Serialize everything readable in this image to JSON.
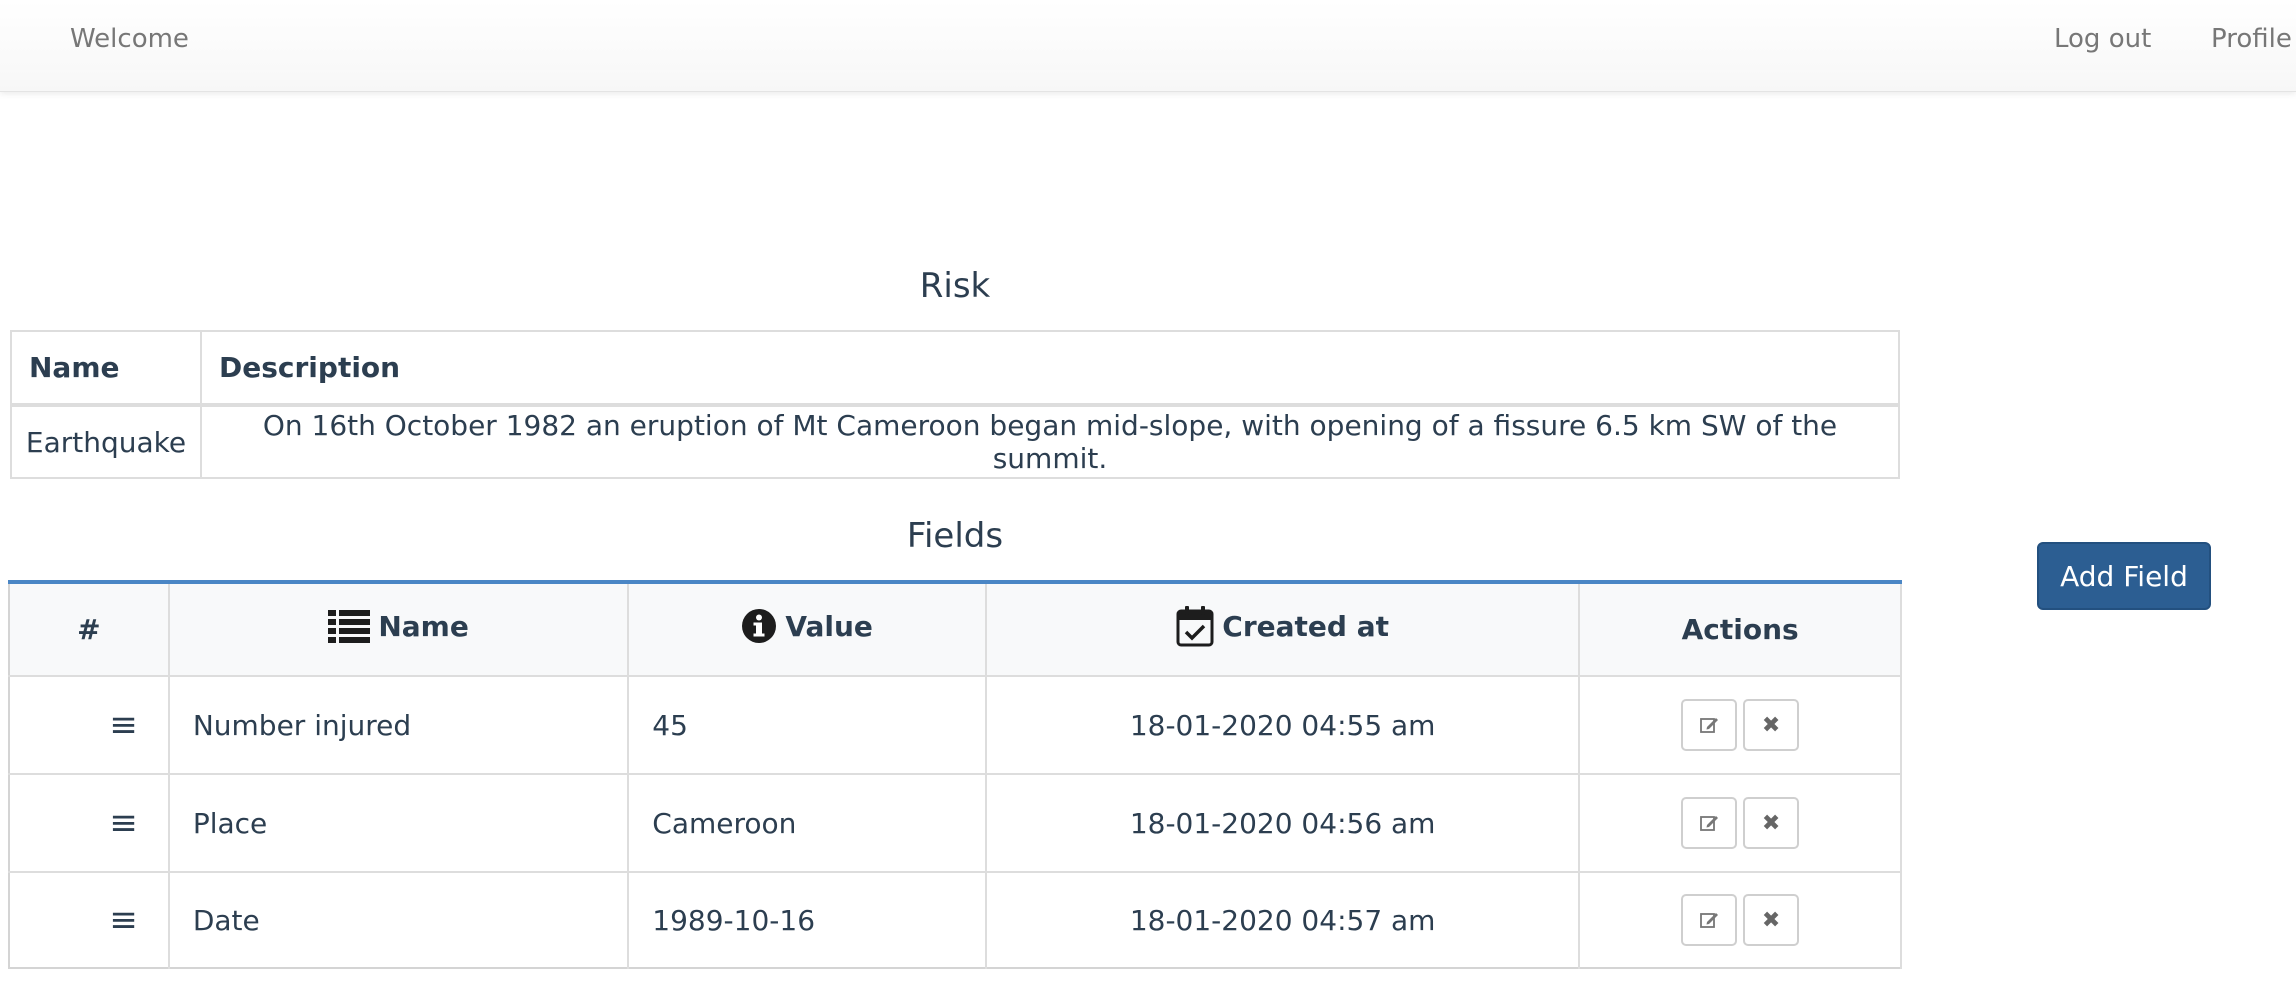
{
  "nav": {
    "brand": "Welcome",
    "logout": "Log out",
    "profile": "Profile"
  },
  "risk": {
    "title": "Risk",
    "headers": {
      "name": "Name",
      "description": "Description"
    },
    "row": {
      "name": "Earthquake",
      "description": "On 16th October 1982 an eruption of Mt Cameroon began mid-slope, with opening of a fissure 6.5 km SW of the summit."
    }
  },
  "fields": {
    "title": "Fields",
    "headers": {
      "num": "#",
      "name": "Name",
      "value": "Value",
      "created": "Created at",
      "actions": "Actions"
    },
    "rows": [
      {
        "name": "Number injured",
        "value": "45",
        "created": "18-01-2020 04:55 am"
      },
      {
        "name": "Place",
        "value": "Cameroon",
        "created": "18-01-2020 04:56 am"
      },
      {
        "name": "Date",
        "value": "1989-10-16",
        "created": "18-01-2020 04:57 am"
      }
    ]
  },
  "add_field_label": "Add Field",
  "icons": {
    "name_header": "list-icon",
    "value_header": "info-circle-icon",
    "created_header": "calendar-check-icon",
    "row_handle": "drag-handle-icon",
    "edit": "edit-icon",
    "delete": "close-icon"
  },
  "colors": {
    "accent": "#4a86c5",
    "button": "#2c5e92",
    "text": "#2c3e50"
  }
}
